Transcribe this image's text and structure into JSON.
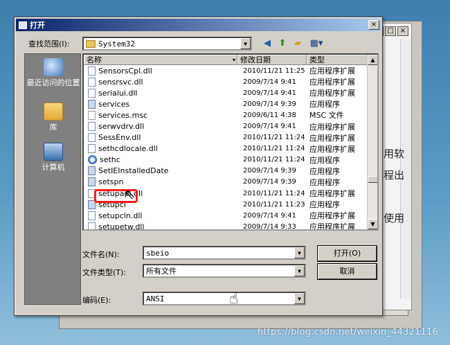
{
  "dialog": {
    "title": "打开",
    "close_label": "×",
    "look_in_label": "查找范围(I):",
    "look_in_value": "System32"
  },
  "bg_window": {
    "controls": [
      "_",
      "□",
      "×"
    ],
    "side_texts": [
      "用软",
      "程出",
      "使用"
    ]
  },
  "places": [
    {
      "label": "最近访问的位置",
      "icon": "recent-places-icon"
    },
    {
      "label": "库",
      "icon": "library-icon"
    },
    {
      "label": "计算机",
      "icon": "computer-icon"
    }
  ],
  "file_list": {
    "columns": [
      "名称",
      "修改日期",
      "类型"
    ],
    "rows": [
      {
        "name": "SensorsCpl.dll",
        "date": "2010/11/21 11:25",
        "type": "应用程序扩展",
        "icon": "dll"
      },
      {
        "name": "sensrsvc.dll",
        "date": "2009/7/14 9:41",
        "type": "应用程序扩展",
        "icon": "dll"
      },
      {
        "name": "serialui.dll",
        "date": "2009/7/14 9:41",
        "type": "应用程序扩展",
        "icon": "dll"
      },
      {
        "name": "services",
        "date": "2009/7/14 9:39",
        "type": "应用程序",
        "icon": "exe"
      },
      {
        "name": "services.msc",
        "date": "2009/6/11 4:38",
        "type": "MSC 文件",
        "icon": "msc"
      },
      {
        "name": "serwvdrv.dll",
        "date": "2009/7/14 9:41",
        "type": "应用程序扩展",
        "icon": "dll"
      },
      {
        "name": "SessEnv.dll",
        "date": "2010/11/21 11:24",
        "type": "应用程序扩展",
        "icon": "dll"
      },
      {
        "name": "sethcdlocale.dll",
        "date": "2010/11/21 11:24",
        "type": "应用程序扩展",
        "icon": "dll"
      },
      {
        "name": "sethc",
        "date": "2010/11/21 11:24",
        "type": "应用程序",
        "icon": "sethc"
      },
      {
        "name": "SetIEInstalledDate",
        "date": "2009/7/14 9:39",
        "type": "应用程序",
        "icon": "exe"
      },
      {
        "name": "setspn",
        "date": "2009/7/14 9:39",
        "type": "应用程序",
        "icon": "exe"
      },
      {
        "name": "setupapi.dll",
        "date": "2010/11/21 11:24",
        "type": "应用程序扩展",
        "icon": "dll"
      },
      {
        "name": "setupcl",
        "date": "2010/11/21 11:23",
        "type": "应用程序",
        "icon": "exe"
      },
      {
        "name": "setupcln.dll",
        "date": "2009/7/14 9:41",
        "type": "应用程序扩展",
        "icon": "dll"
      },
      {
        "name": "setupetw.dll",
        "date": "2009/7/14 9:33",
        "type": "应用程序扩展",
        "icon": "dll"
      }
    ]
  },
  "filename": {
    "label": "文件名(N):",
    "value": "sbeio"
  },
  "filetype": {
    "label": "文件类型(T):",
    "value": "所有文件"
  },
  "encoding": {
    "label": "编码(E):",
    "value": "ANSI"
  },
  "buttons": {
    "open": "打开(O)",
    "cancel": "取消"
  },
  "watermark": "https://blog.csdn.net/weixin_44321116",
  "colors": {
    "highlight": "#ff1a1a",
    "titlebar": "#0a246a"
  }
}
